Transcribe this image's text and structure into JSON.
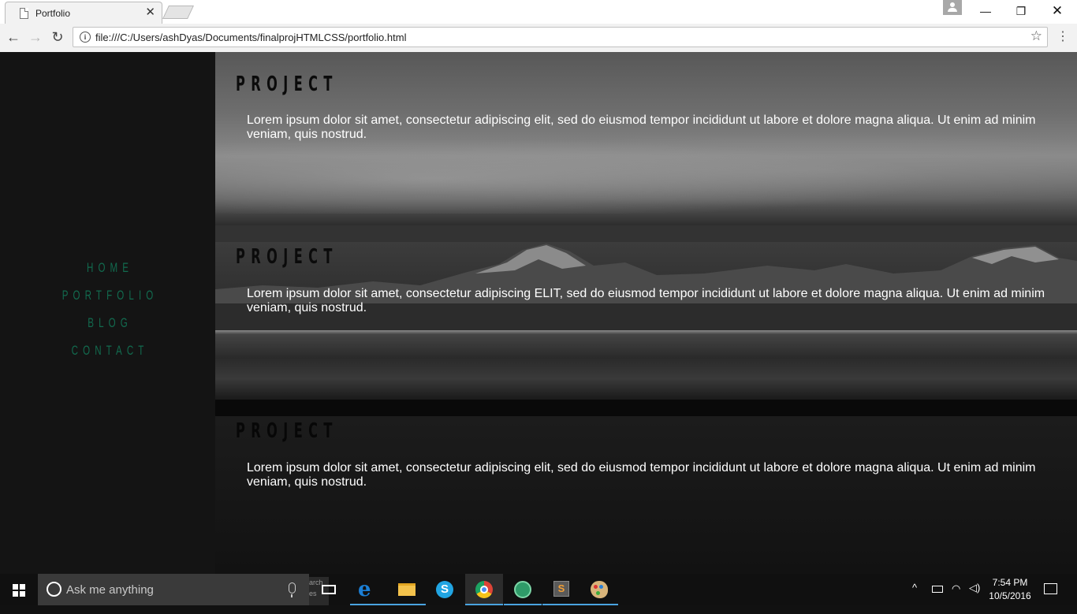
{
  "browser": {
    "tab_title": "Portfolio",
    "tab_close": "✕",
    "url": "file:///C:/Users/ashDyas/Documents/finalprojHTMLCSS/portfolio.html",
    "window_buttons": {
      "minimize": "—",
      "maximize": "❐",
      "close": "✕"
    },
    "nav": {
      "back": "←",
      "forward": "→",
      "reload": "↻",
      "info": "i",
      "star": "☆",
      "menu": "⋮"
    }
  },
  "sidebar": {
    "items": [
      {
        "label": "HOME"
      },
      {
        "label": "PORTFOLIO"
      },
      {
        "label": "BLOG"
      },
      {
        "label": "CONTACT"
      }
    ]
  },
  "projects": [
    {
      "title": "PROJECT",
      "text": "Lorem ipsum dolor sit amet, consectetur adipiscing elit, sed do eiusmod tempor incididunt ut labore et dolore magna aliqua. Ut enim ad minim veniam, quis nostrud."
    },
    {
      "title": "PROJECT",
      "text": "Lorem ipsum dolor sit amet, consectetur adipiscing ELIT, sed do eiusmod tempor incididunt ut labore et dolore magna aliqua. Ut enim ad minim veniam, quis nostrud."
    },
    {
      "title": "PROJECT",
      "text": "Lorem ipsum dolor sit amet, consectetur adipiscing elit, sed do eiusmod tempor incididunt ut labore et dolore magna aliqua. Ut enim ad minim veniam, quis nostrud."
    }
  ],
  "colors": {
    "nav_link": "#126b4f",
    "sidebar_bg": "#141414",
    "taskbar_bg": "#101010"
  },
  "taskbar": {
    "search_placeholder": "Ask me anything",
    "stray_text": "arch es",
    "skype_letter": "S",
    "sublime_letter": "S",
    "edge_letter": "e",
    "clock_time": "7:54 PM",
    "clock_date": "10/5/2016",
    "tray_chevron": "^",
    "tray_wifi": "◠",
    "tray_volume": "◁)"
  }
}
